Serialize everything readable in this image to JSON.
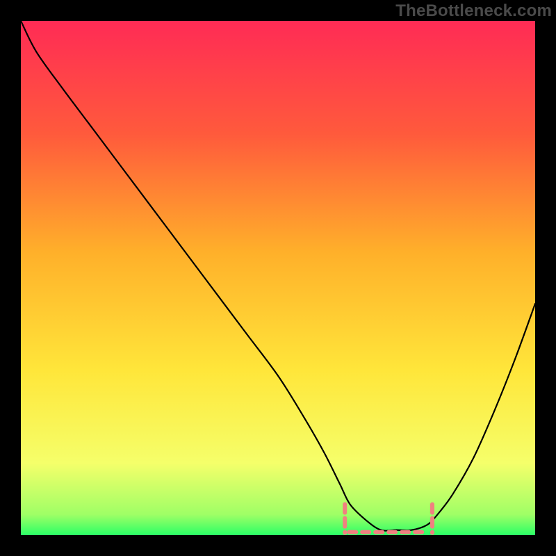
{
  "watermark": "TheBottleneck.com",
  "colors": {
    "page_bg": "#000000",
    "curve": "#000000",
    "bracket": "#f08080",
    "gradient_stops": [
      {
        "offset": "0%",
        "color": "#ff2b55"
      },
      {
        "offset": "22%",
        "color": "#ff5a3c"
      },
      {
        "offset": "45%",
        "color": "#ffb02a"
      },
      {
        "offset": "68%",
        "color": "#ffe63a"
      },
      {
        "offset": "86%",
        "color": "#f5ff6a"
      },
      {
        "offset": "96%",
        "color": "#9fff66"
      },
      {
        "offset": "100%",
        "color": "#2bff66"
      }
    ]
  },
  "chart_data": {
    "type": "line",
    "title": "",
    "xlabel": "",
    "ylabel": "",
    "xlim": [
      0,
      100
    ],
    "ylim": [
      0,
      100
    ],
    "grid": false,
    "series": [
      {
        "name": "bottleneck-curve",
        "x": [
          0,
          3,
          8,
          14,
          20,
          26,
          32,
          38,
          44,
          50,
          55,
          59,
          62,
          64,
          67,
          70,
          73,
          76,
          79,
          81,
          84,
          88,
          92,
          96,
          100
        ],
        "y": [
          100,
          94,
          87,
          79,
          71,
          63,
          55,
          47,
          39,
          31,
          23,
          16,
          10,
          6,
          3,
          1,
          1,
          1,
          2,
          4,
          8,
          15,
          24,
          34,
          45
        ]
      }
    ],
    "flat_region": {
      "x_start": 63,
      "x_end": 80,
      "y": 1,
      "bracket_height": 5
    }
  }
}
